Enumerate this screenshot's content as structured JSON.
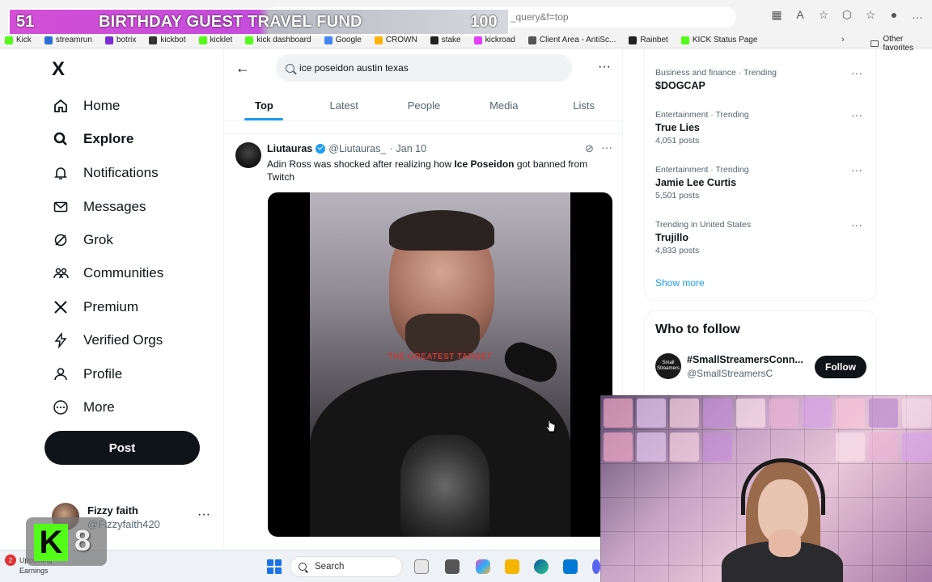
{
  "overlay": {
    "left_number": "51",
    "title": "BIRTHDAY GUEST TRAVEL FUND",
    "right_number": "100",
    "kick_letter": "K",
    "kick_count": "8"
  },
  "browser": {
    "address_fragment": "x.com/search?q=ice poseidon austin texas&src=typed_query&f=top",
    "bookmarks": [
      "Kick",
      "streamrun",
      "botrix",
      "kickbot",
      "kicklet",
      "kick dashboard",
      "Google",
      "CROWN",
      "stake",
      "kickroad",
      "Client Area - AntiSc...",
      "Rainbet",
      "KICK Status Page"
    ],
    "bookmark_colors": [
      "#53fc18",
      "#2b6fd6",
      "#7a2bd6",
      "#333333",
      "#53fc18",
      "#53fc18",
      "#4285f4",
      "#ffb300",
      "#222222",
      "#e040fb",
      "#555555",
      "#222222",
      "#53fc18"
    ],
    "other_favorites": "Other favorites"
  },
  "nav": {
    "logo": "X",
    "items": [
      {
        "label": "Home",
        "icon": "home-icon"
      },
      {
        "label": "Explore",
        "icon": "search-icon"
      },
      {
        "label": "Notifications",
        "icon": "bell-icon"
      },
      {
        "label": "Messages",
        "icon": "envelope-icon"
      },
      {
        "label": "Grok",
        "icon": "grok-icon"
      },
      {
        "label": "Communities",
        "icon": "people-icon"
      },
      {
        "label": "Premium",
        "icon": "x-icon"
      },
      {
        "label": "Verified Orgs",
        "icon": "lightning-icon"
      },
      {
        "label": "Profile",
        "icon": "person-icon"
      },
      {
        "label": "More",
        "icon": "more-circle-icon"
      }
    ],
    "post_label": "Post",
    "profile": {
      "name": "Fizzy faith",
      "handle": "@Fizzyfaith420"
    }
  },
  "search": {
    "query": "ice poseidon austin texas",
    "tabs": [
      "Top",
      "Latest",
      "People",
      "Media",
      "Lists"
    ],
    "active_tab": "Top"
  },
  "tweet": {
    "author": "Liutauras",
    "handle": "@Liutauras_",
    "separator": "·",
    "date": "Jan 10",
    "text_before": "Adin Ross was shocked after realizing how ",
    "text_bold": "Ice Poseidon",
    "text_after": " got banned from Twitch",
    "video_caption": "THE GREATEST TARGET"
  },
  "trends": [
    {
      "context": "Business and finance · Trending",
      "name": "$DOGCAP",
      "count": ""
    },
    {
      "context": "Entertainment · Trending",
      "name": "True Lies",
      "count": "4,051 posts"
    },
    {
      "context": "Entertainment · Trending",
      "name": "Jamie Lee Curtis",
      "count": "5,501 posts"
    },
    {
      "context": "Trending in United States",
      "name": "Trujillo",
      "count": "4,833 posts"
    }
  ],
  "show_more": "Show more",
  "who_to_follow": {
    "title": "Who to follow",
    "name": "#SmallStreamersConn...",
    "handle": "@SmallStreamersC",
    "avatar_text": "Small Streamers",
    "follow_label": "Follow"
  },
  "taskbar": {
    "badge": "2",
    "weather_line1": "Upcoming",
    "weather_line2": "Earnings",
    "search_label": "Search"
  }
}
